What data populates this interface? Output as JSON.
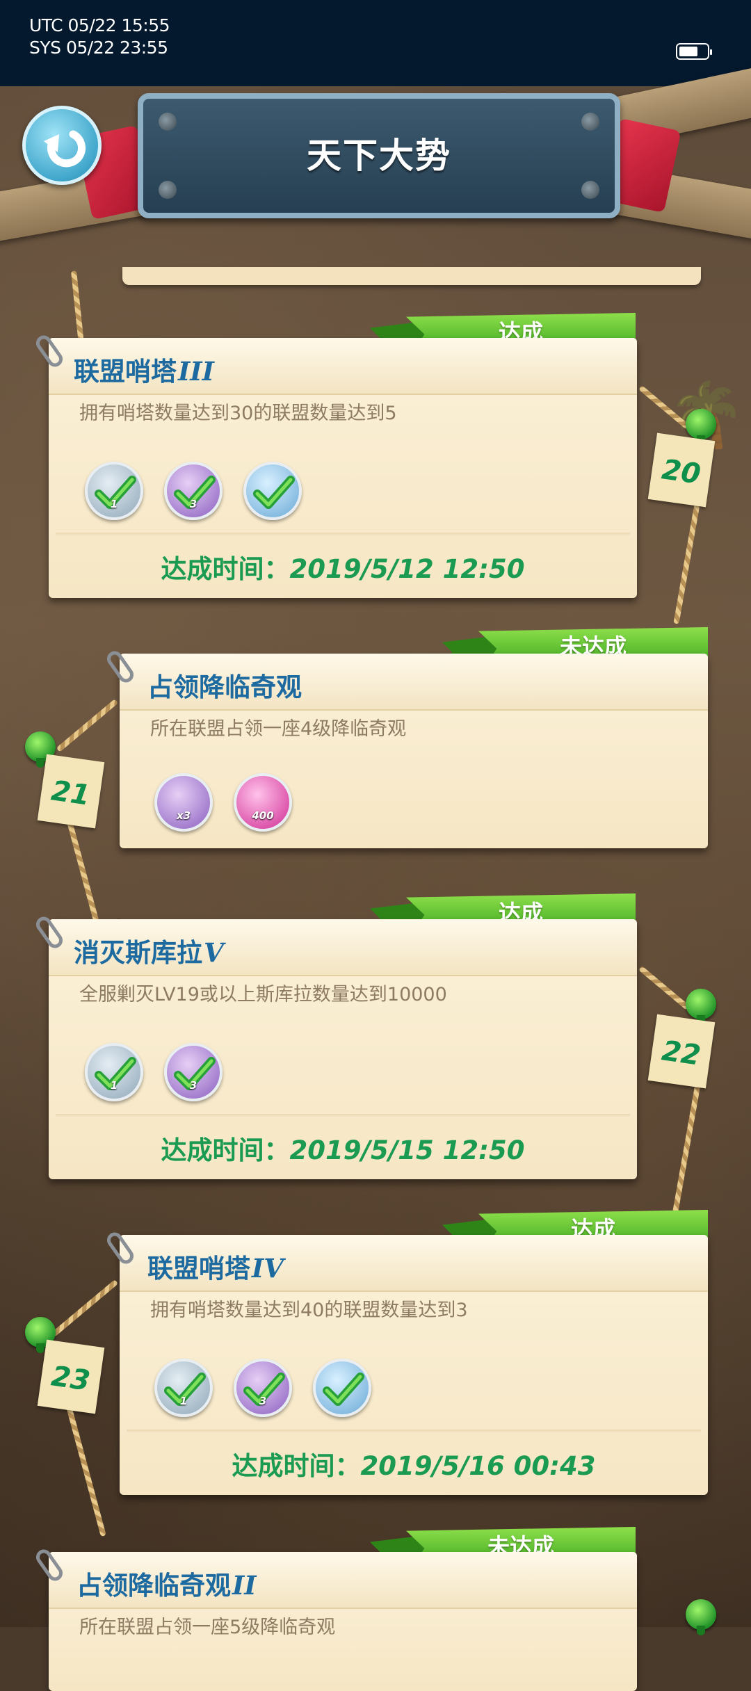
{
  "status_bar": {
    "utc": "UTC 05/22 15:55",
    "sys": "SYS 05/22 23:55"
  },
  "header": {
    "title": "天下大势",
    "back_icon": "back-arrow-icon"
  },
  "status_labels": {
    "done": "达成",
    "pending": "未达成"
  },
  "achievements": [
    {
      "number": "20",
      "name": "联盟哨塔",
      "roman": "III",
      "status": "达成",
      "description": "拥有哨塔数量达到30的联盟数量达到5",
      "rewards": [
        {
          "icon": "silver-shield-icon",
          "qty": "1",
          "claimed": true
        },
        {
          "icon": "purple-scroll-icon",
          "qty": "3",
          "claimed": true
        },
        {
          "icon": "blue-ship-icon",
          "qty": "",
          "claimed": true
        }
      ],
      "time_label": "达成时间：",
      "time_value": "2019/5/12 12:50"
    },
    {
      "number": "21",
      "name": "占领降临奇观",
      "roman": "",
      "status": "未达成",
      "description": "所在联盟占领一座4级降临奇观",
      "rewards": [
        {
          "icon": "purple-scroll-icon",
          "qty": "x3",
          "claimed": false
        },
        {
          "icon": "pink-crystal-icon",
          "qty": "400",
          "claimed": false
        }
      ],
      "time_label": "",
      "time_value": ""
    },
    {
      "number": "22",
      "name": "消灭斯库拉",
      "roman": "V",
      "status": "达成",
      "description": "全服剿灭LV19或以上斯库拉数量达到10000",
      "rewards": [
        {
          "icon": "silver-shield-icon",
          "qty": "1",
          "claimed": true
        },
        {
          "icon": "purple-scroll-icon",
          "qty": "3",
          "claimed": true
        }
      ],
      "time_label": "达成时间：",
      "time_value": "2019/5/15 12:50"
    },
    {
      "number": "23",
      "name": "联盟哨塔",
      "roman": "IV",
      "status": "达成",
      "description": "拥有哨塔数量达到40的联盟数量达到3",
      "rewards": [
        {
          "icon": "silver-shield-icon",
          "qty": "1",
          "claimed": true
        },
        {
          "icon": "purple-scroll-icon",
          "qty": "3",
          "claimed": true
        },
        {
          "icon": "blue-ship-icon",
          "qty": "",
          "claimed": true
        }
      ],
      "time_label": "达成时间：",
      "time_value": "2019/5/16 00:43"
    },
    {
      "number": "",
      "name": "占领降临奇观",
      "roman": "II",
      "status": "未达成",
      "description": "所在联盟占领一座5级降临奇观",
      "rewards": [],
      "time_label": "",
      "time_value": ""
    }
  ],
  "colors": {
    "status_bar_bg": "#04192e",
    "title_panel": "#2f4a5e",
    "achievement_name": "#1d6aa0",
    "time_text": "#1b9a52",
    "banner_green": "#4fb52a",
    "card_bg": "#f8ecd0"
  }
}
